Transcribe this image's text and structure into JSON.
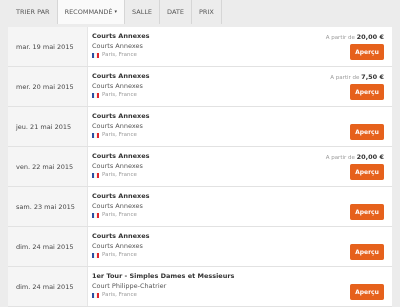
{
  "sort": {
    "label": "TRIER PAR",
    "options": [
      {
        "label": "RECOMMANDÉ",
        "active": true,
        "caret": "▾"
      },
      {
        "label": "SALLE"
      },
      {
        "label": "DATE"
      },
      {
        "label": "PRIX"
      }
    ]
  },
  "events": [
    {
      "date": "mar. 19 mai 2015",
      "title": "Courts Annexes",
      "venue": "Courts Annexes",
      "location": "Paris, France",
      "price_prefix": "A partir de",
      "price": "20,00 €",
      "button": "Aperçu"
    },
    {
      "date": "mer. 20 mai 2015",
      "title": "Courts Annexes",
      "venue": "Courts Annexes",
      "location": "Paris, France",
      "price_prefix": "A partir de",
      "price": "7,50 €",
      "button": "Aperçu"
    },
    {
      "date": "jeu. 21 mai 2015",
      "title": "Courts Annexes",
      "venue": "Courts Annexes",
      "location": "Paris, France",
      "price_prefix": "",
      "price": "",
      "button": "Aperçu"
    },
    {
      "date": "ven. 22 mai 2015",
      "title": "Courts Annexes",
      "venue": "Courts Annexes",
      "location": "Paris, France",
      "price_prefix": "A partir de",
      "price": "20,00 €",
      "button": "Aperçu"
    },
    {
      "date": "sam. 23 mai 2015",
      "title": "Courts Annexes",
      "venue": "Courts Annexes",
      "location": "Paris, France",
      "price_prefix": "",
      "price": "",
      "button": "Aperçu"
    },
    {
      "date": "dim. 24 mai 2015",
      "title": "Courts Annexes",
      "venue": "Courts Annexes",
      "location": "Paris, France",
      "price_prefix": "",
      "price": "",
      "button": "Aperçu"
    },
    {
      "date": "dim. 24 mai 2015",
      "title": "1er Tour - Simples Dames et Messieurs",
      "venue": "Court Philippe-Chatrier",
      "location": "Paris, France",
      "price_prefix": "",
      "price": "",
      "button": "Aperçu"
    }
  ],
  "colors": {
    "button": "#e6611c",
    "flag": [
      "#2b4ea2",
      "#ffffff",
      "#e1262d"
    ]
  },
  "icons": {
    "flag": "flag-fr-icon",
    "caret": "chevron-down-icon"
  }
}
